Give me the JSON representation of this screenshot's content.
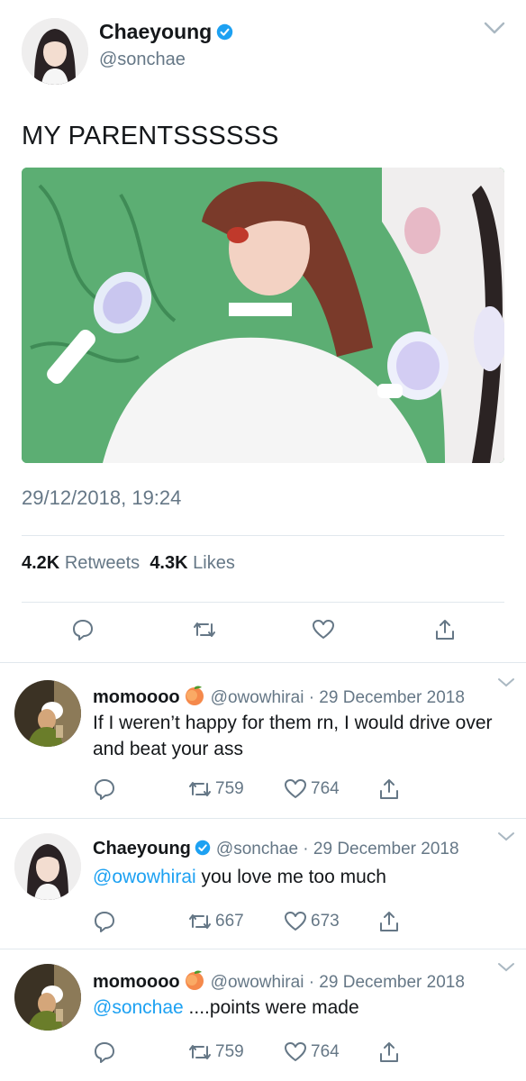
{
  "main_tweet": {
    "author_name": "Chaeyoung",
    "author_handle": "@sonchae",
    "text": "MY PARENTSSSSSS",
    "timestamp": "29/12/2018, 19:24",
    "retweets_count": "4.2K",
    "retweets_label": "Retweets",
    "likes_count": "4.3K",
    "likes_label": "Likes",
    "icons": [
      "verified-badge-icon",
      "chevron-down-icon",
      "reply-icon",
      "retweet-icon",
      "like-heart-icon",
      "share-icon"
    ]
  },
  "replies": [
    {
      "author_name": "momoooo",
      "emoji": "peach",
      "meta": "@owowhirai · 29 December 2018",
      "mention": "",
      "text": "If I weren’t happy for them rn, I would drive over and beat your ass",
      "retweets": "759",
      "likes": "764"
    },
    {
      "author_name": "Chaeyoung",
      "emoji": "verified",
      "meta": "@sonchae · 29 December 2018",
      "mention": "@owowhirai",
      "text": " you love me too much",
      "retweets": "667",
      "likes": "673"
    },
    {
      "author_name": "momoooo",
      "emoji": "peach",
      "meta": "@owowhirai · 29 December 2018",
      "mention": "@sonchae",
      "text": " ....points were made",
      "retweets": "759",
      "likes": "764"
    }
  ],
  "colors": {
    "text": "#14171a",
    "secondary": "#657786",
    "link": "#1da1f2",
    "divider": "#e1e8ed",
    "media_green": "#5cae73"
  }
}
